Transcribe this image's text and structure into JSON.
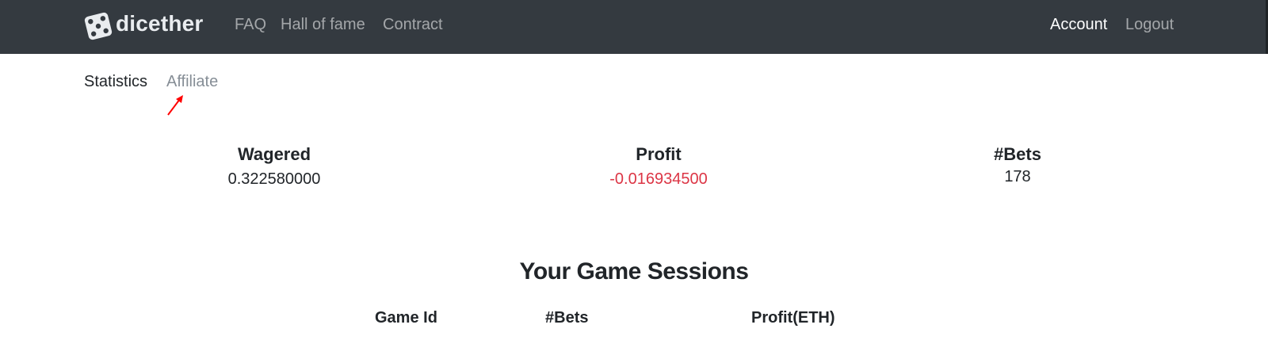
{
  "navbar": {
    "brand": "dicether",
    "brand_icon": "dice-icon",
    "links": [
      {
        "label": "FAQ"
      },
      {
        "label": "Hall of fame"
      },
      {
        "label": "Contract"
      }
    ],
    "account_label": "Account",
    "logout_label": "Logout"
  },
  "subnav": {
    "tabs": [
      {
        "label": "Statistics",
        "active": true
      },
      {
        "label": "Affiliate",
        "active": false
      }
    ]
  },
  "stats": {
    "wagered": {
      "label": "Wagered",
      "value": "0.322580000"
    },
    "profit": {
      "label": "Profit",
      "value": "-0.016934500",
      "color": "#dc3545"
    },
    "bets": {
      "label": "#Bets",
      "value": "178"
    }
  },
  "sessions": {
    "title": "Your Game Sessions",
    "columns": [
      "Game Id",
      "#Bets",
      "Profit(ETH)"
    ]
  },
  "colors": {
    "navbar_bg": "#343a40",
    "annotation_arrow": "#ff0000",
    "negative": "#dc3545"
  }
}
